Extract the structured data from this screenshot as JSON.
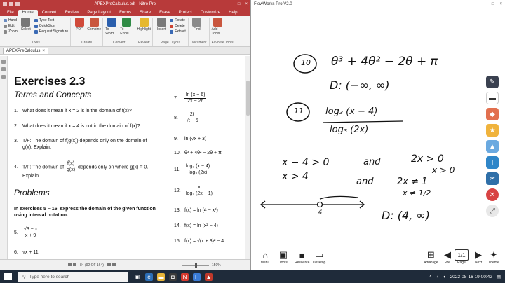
{
  "nitro": {
    "window_title": "APEXPreCalculus.pdf - Nitro Pro",
    "menu_tabs": [
      "File",
      "Home",
      "Convert",
      "Review",
      "Page Layout",
      "Forms",
      "Share",
      "Erase",
      "Protect",
      "Customize",
      "Help"
    ],
    "active_tab": "Home",
    "ribbon": {
      "tools_small": [
        "Hand",
        "Edit",
        "Zoom"
      ],
      "select_label": "Select",
      "type_text": "Type Text",
      "quicksign": "QuickSign",
      "request_signature": "Request Signature",
      "group_tools": "Tools",
      "pdf_label": "PDF",
      "combine_label": "Combine",
      "group_create": "Create",
      "to_word": "To Word",
      "to_excel": "To Excel",
      "group_convert": "Convert",
      "highlight": "Highlight",
      "group_review": "Review",
      "insert": "Insert",
      "rotate": "Rotate",
      "delete": "Delete",
      "extract": "Extract",
      "group_page_layout": "Page Layout",
      "find": "Find",
      "group_document": "Document",
      "add_tools": "Add Tools",
      "group_favorite": "Favorite Tools"
    },
    "doc_tab": "APEXPreCalculus",
    "page": {
      "heading": "Exercises 2.3",
      "terms_heading": "Terms and Concepts",
      "ex1": "What does it mean if x = 2 is in the domain of f(x)?",
      "ex2": "What does it mean if x = 4 is not in the domain of f(x)?",
      "ex3a": "T/F: The domain of f(g(x)) depends only on the domain of",
      "ex3b": "g(x). Explain.",
      "ex4a": "T/F: The domain of",
      "ex4frac_num": "f(x)",
      "ex4frac_den": "g(x)",
      "ex4b": "depends only on where g(x) = 0.",
      "ex4c": "Explain.",
      "problems_heading": "Problems",
      "instr1": "In exercises  5 – 16, express the domain of the given function",
      "instr2": "using interval notation.",
      "ex5_num": "√3 − x",
      "ex5_den": "x + 9",
      "ex6": "√x + 11",
      "ex7_num": "ln (x − 6)",
      "ex7_den": "2x − 26",
      "ex8_num": "2t",
      "ex8_den": "√t − 5",
      "ex9": "ln (√x + 3)",
      "ex10": "θ³ + 4θ² − 2θ + π",
      "ex11_num": "log₃ (x − 4)",
      "ex11_den": "log₃ (2x)",
      "ex12_num": "x",
      "ex12_den": "log₂ (2x − 1)",
      "ex13": "f(x) = ln (4 − x²)",
      "ex14": "f(x) = ln (x² − 4)",
      "ex15": "f(x) = √(x + 3)² − 4",
      "labels": [
        "1.",
        "2.",
        "3.",
        "4.",
        "5.",
        "6.",
        "7.",
        "8.",
        "9.",
        "10.",
        "11.",
        "12.",
        "13.",
        "14.",
        "15."
      ]
    },
    "status": {
      "page_indicator": "84 (92 OF 164)",
      "zoom": "150%"
    }
  },
  "flow": {
    "window_title": "FlowWorks Pro V2.0",
    "ink": {
      "n10": "10",
      "expr10": "θ³ + 4θ² − 2θ + π",
      "d10": "D: (−∞, ∞)",
      "n11": "11",
      "num11": "log₃ (x − 4)",
      "den11": "log₃ (2x)",
      "c1": "x − 4 > 0",
      "and1": "and",
      "c2": "2x > 0",
      "c3": "x > 4",
      "c4": "x > 0",
      "and2": "and",
      "c5": "2x ≠ 1",
      "c6": "x ≠ 1/2",
      "tick4": "4",
      "d11": "D: (4, ∞)"
    },
    "bottom_tools": [
      "Menu",
      "Tools",
      "Resource",
      "Desktop"
    ],
    "right_tools": [
      "AddPage",
      "Pre",
      "Page",
      "Next",
      "Theme"
    ],
    "page_counter": "1/1"
  },
  "taskbar": {
    "search_placeholder": "Type here to search",
    "datetime": "2022-08-16  19:00:42"
  },
  "colors": {
    "nitro_red": "#b83a3a",
    "taskbar": "#1f2b3a"
  }
}
